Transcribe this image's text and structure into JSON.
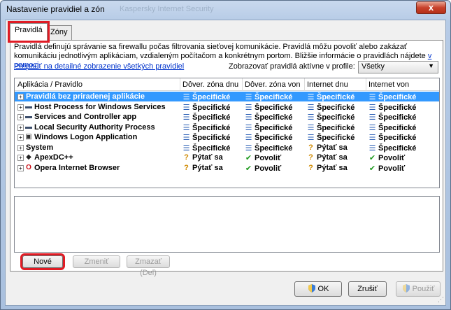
{
  "window": {
    "title": "Nastavenie pravidiel a zón",
    "ghost_title": "Kaspersky Internet Security",
    "close_label": "x"
  },
  "tabs": [
    {
      "label": "Pravidlá",
      "active": true
    },
    {
      "label": "Zóny",
      "active": false
    }
  ],
  "description": {
    "text": "Pravidlá definujú správanie sa firewallu počas filtrovania sieťovej komunikácie. Pravidlá môžu povoliť alebo zakázať komunikáciu jednotlivým aplikáciam, vzdialeným počítačom a konkrétnym portom. Bližšie informácie o pravidlách nájdete ",
    "help_link": "v pomoci",
    "end": "."
  },
  "detail_link": "Prepnúť na detailné zobrazenie všetkých pravidiel",
  "profile": {
    "label": "Zobrazovať pravidlá aktívne v profile:",
    "value": "Všetky"
  },
  "columns": [
    "Aplikácia / Pravidlo",
    "Dôver. zóna dnu",
    "Dôver. zóna von",
    "Internet dnu",
    "Internet von"
  ],
  "rows": [
    {
      "name": "Pravidlá bez priradenej aplikácie",
      "icon": "none",
      "selected": true,
      "c1": "Špecifické",
      "c2": "Špecifické",
      "c3": "Špecifické",
      "c4": "Špecifické",
      "t1": "spec",
      "t2": "spec",
      "t3": "spec",
      "t4": "spec"
    },
    {
      "name": "Host Process for Windows Services",
      "icon": "window-icon",
      "selected": false,
      "c1": "Špecifické",
      "c2": "Špecifické",
      "c3": "Špecifické",
      "c4": "Špecifické",
      "t1": "spec",
      "t2": "spec",
      "t3": "spec",
      "t4": "spec"
    },
    {
      "name": "Services and Controller app",
      "icon": "window-icon",
      "selected": false,
      "c1": "Špecifické",
      "c2": "Špecifické",
      "c3": "Špecifické",
      "c4": "Špecifické",
      "t1": "spec",
      "t2": "spec",
      "t3": "spec",
      "t4": "spec"
    },
    {
      "name": "Local Security Authority Process",
      "icon": "window-icon",
      "selected": false,
      "c1": "Špecifické",
      "c2": "Špecifické",
      "c3": "Špecifické",
      "c4": "Špecifické",
      "t1": "spec",
      "t2": "spec",
      "t3": "spec",
      "t4": "spec"
    },
    {
      "name": "Windows Logon Application",
      "icon": "monitor-icon",
      "selected": false,
      "c1": "Špecifické",
      "c2": "Špecifické",
      "c3": "Špecifické",
      "c4": "Špecifické",
      "t1": "spec",
      "t2": "spec",
      "t3": "spec",
      "t4": "spec"
    },
    {
      "name": "System",
      "icon": "none",
      "selected": false,
      "c1": "Špecifické",
      "c2": "Špecifické",
      "c3": "Pýtať sa",
      "c4": "Špecifické",
      "t1": "spec",
      "t2": "spec",
      "t3": "ask",
      "t4": "spec"
    },
    {
      "name": "ApexDC++",
      "icon": "apex-icon",
      "selected": false,
      "c1": "Pýtať sa",
      "c2": "Povoliť",
      "c3": "Pýtať sa",
      "c4": "Povoliť",
      "t1": "ask",
      "t2": "allow",
      "t3": "ask",
      "t4": "allow"
    },
    {
      "name": "Opera Internet Browser",
      "icon": "opera-icon",
      "selected": false,
      "c1": "Pýtať sa",
      "c2": "Povoliť",
      "c3": "Pýtať sa",
      "c4": "Povoliť",
      "t1": "ask",
      "t2": "allow",
      "t3": "ask",
      "t4": "allow"
    }
  ],
  "icons": {
    "spec": "☰",
    "ask": "?",
    "allow": "✔"
  },
  "buttons": {
    "new": "Nové",
    "edit": "Zmeniť",
    "delete": "Zmazať (Del)",
    "ok": "OK",
    "cancel": "Zrušiť",
    "apply": "Použiť"
  },
  "colors": {
    "selection": "#3399ff",
    "highlight": "#e01b24",
    "link": "#0033cc"
  }
}
